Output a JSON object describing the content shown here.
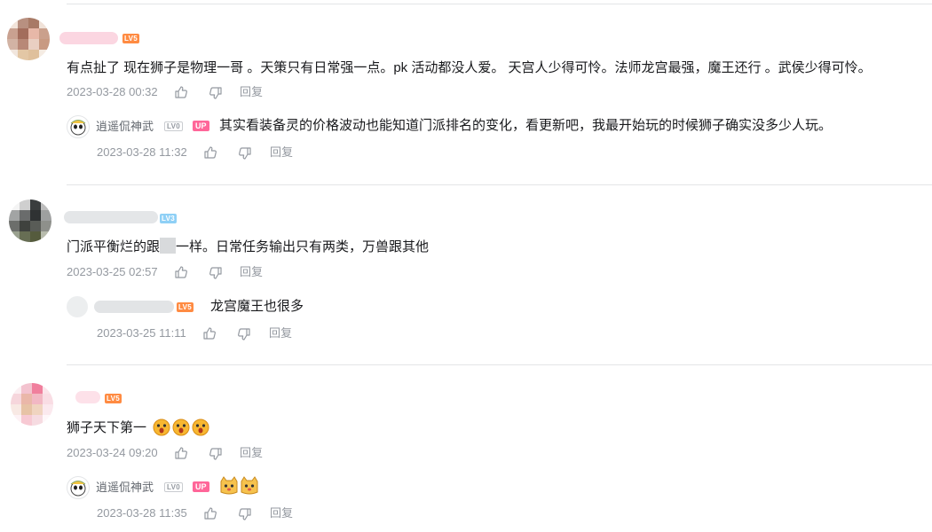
{
  "comments": [
    {
      "user_level": "LV5",
      "text": "有点扯了 现在狮子是物理一哥 。天策只有日常强一点。pk 活动都没人爱。 天宫人少得可怜。法师龙宫最强，魔王还行 。武侯少得可怜。",
      "time": "2023-03-28 00:32",
      "reply_label": "回复",
      "reply": {
        "name": "逍遥侃神武",
        "user_level": "LV0",
        "badge": "UP",
        "text": "其实看装备灵的价格波动也能知道门派排名的变化，看更新吧，我最开始玩的时候狮子确实没多少人玩。",
        "time": "2023-03-28 11:32",
        "reply_label": "回复"
      }
    },
    {
      "user_level": "LV3",
      "text_a": "门派平衡烂的跟",
      "text_b": "一样。日常任务输出只有两类，万兽跟其他",
      "time": "2023-03-25 02:57",
      "reply_label": "回复",
      "reply": {
        "user_level": "LV5",
        "text": "龙宫魔王也很多",
        "time": "2023-03-25 11:11",
        "reply_label": "回复"
      }
    },
    {
      "user_level": "LV5",
      "text": "狮子天下第一",
      "time": "2023-03-24 09:20",
      "reply_label": "回复",
      "reply": {
        "name": "逍遥侃神武",
        "user_level": "LV0",
        "badge": "UP",
        "time": "2023-03-28 11:35",
        "reply_label": "回复"
      }
    }
  ],
  "icons": {
    "like": "thumbs-up-icon",
    "dislike": "thumbs-down-icon"
  }
}
